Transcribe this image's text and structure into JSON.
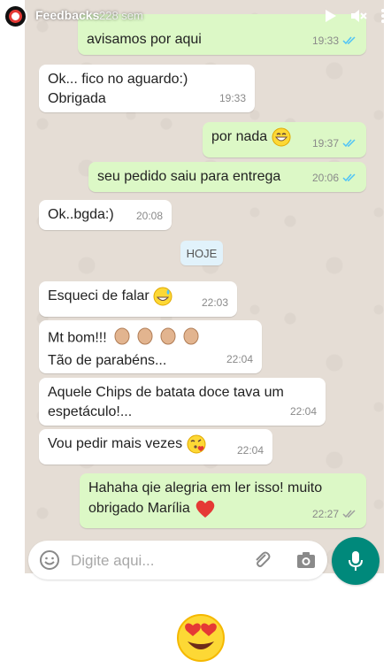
{
  "story": {
    "username": "Feedbacks",
    "time_ago": "228 sem"
  },
  "messages": [
    {
      "id": "m0",
      "text_line1": "avisamos por aqui",
      "time": "19:33",
      "dir": "out",
      "ticks": "read"
    },
    {
      "id": "m1",
      "text_line1": "Ok... fico no aguardo:)",
      "text_line2": "Obrigada",
      "time": "19:33",
      "dir": "in"
    },
    {
      "id": "m2",
      "text_line1": "por nada",
      "time": "19:37",
      "dir": "out",
      "ticks": "read",
      "emoji": "grin"
    },
    {
      "id": "m3",
      "text_line1": "seu pedido saiu para entrega",
      "time": "20:06",
      "dir": "out",
      "ticks": "read"
    },
    {
      "id": "m4",
      "text_line1": "Ok..bgda:)",
      "time": "20:08",
      "dir": "in"
    },
    {
      "id": "m5",
      "text_line1": "Esqueci de falar",
      "time": "22:03",
      "dir": "in",
      "emoji": "grin-sweat"
    },
    {
      "id": "m6",
      "text_line1": "Mt bom!!!",
      "text_line2": "Tão de parabéns...",
      "time": "22:04",
      "dir": "in",
      "emoji": "clap-x4"
    },
    {
      "id": "m7",
      "text_line1": "Aquele Chips de batata doce tava um",
      "text_line2": "espetáculo!...",
      "time": "22:04",
      "dir": "in"
    },
    {
      "id": "m8",
      "text_line1": "Vou pedir mais vezes",
      "time": "22:04",
      "dir": "in",
      "emoji": "kiss-heart"
    },
    {
      "id": "m9",
      "text_line1": "Hahaha qie alegria em ler isso! muito",
      "text_line2": "obrigado Marília",
      "time": "22:27",
      "dir": "out",
      "ticks": "delivered",
      "emoji": "red-heart"
    }
  ],
  "date_separator": "HOJE",
  "composer": {
    "placeholder": "Digite aqui..."
  },
  "icons": {
    "emoji": "smiley-icon",
    "attach": "paperclip-icon",
    "camera": "camera-icon",
    "mic": "mic-icon",
    "reaction": "heart-eyes-emoji"
  },
  "colors": {
    "incoming": "#ffffff",
    "outgoing": "#dcf8c6",
    "read_ticks": "#4fc3f7",
    "accent": "#00897b"
  }
}
